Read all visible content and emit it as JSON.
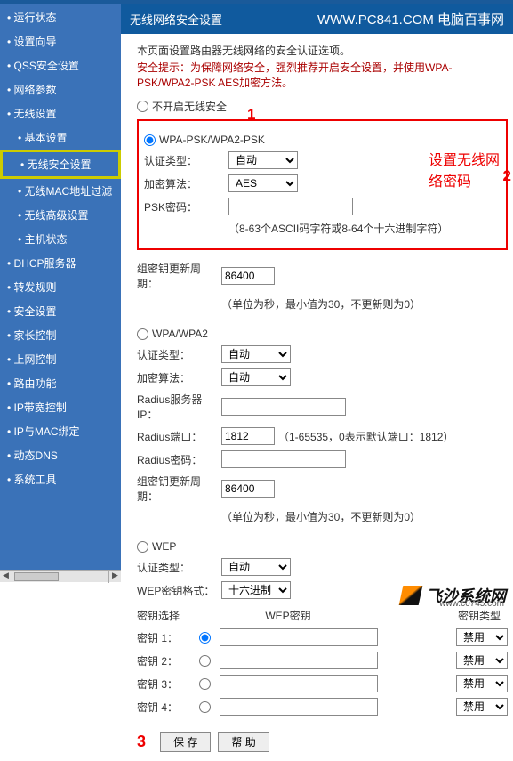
{
  "sidebar": {
    "items": [
      {
        "label": "运行状态"
      },
      {
        "label": "设置向导"
      },
      {
        "label": "QSS安全设置"
      },
      {
        "label": "网络参数"
      },
      {
        "label": "无线设置"
      },
      {
        "label": "DHCP服务器"
      },
      {
        "label": "转发规则"
      },
      {
        "label": "安全设置"
      },
      {
        "label": "家长控制"
      },
      {
        "label": "上网控制"
      },
      {
        "label": "路由功能"
      },
      {
        "label": "IP带宽控制"
      },
      {
        "label": "IP与MAC绑定"
      },
      {
        "label": "动态DNS"
      },
      {
        "label": "系统工具"
      }
    ],
    "wireless_sub": [
      {
        "label": "基本设置"
      },
      {
        "label": "无线安全设置"
      },
      {
        "label": "无线MAC地址过滤"
      },
      {
        "label": "无线高级设置"
      },
      {
        "label": "主机状态"
      }
    ]
  },
  "header": {
    "title": "无线网络安全设置",
    "brand": "WWW.PC841.COM 电脑百事网"
  },
  "intro": {
    "desc": "本页面设置路由器无线网络的安全认证选项。",
    "warn": "安全提示：为保障网络安全，强烈推荐开启安全设置，并使用WPA-PSK/WPA2-PSK AES加密方法。"
  },
  "security_modes": {
    "off": "不开启无线安全",
    "wpa_psk": "WPA-PSK/WPA2-PSK",
    "wpa": "WPA/WPA2",
    "wep": "WEP"
  },
  "wpa_psk": {
    "auth_label": "认证类型：",
    "auth_value": "自动",
    "enc_label": "加密算法：",
    "enc_value": "AES",
    "psk_label": "PSK密码：",
    "psk_hint": "（8-63个ASCII码字符或8-64个十六进制字符）"
  },
  "rekey": {
    "label": "组密钥更新周期：",
    "value": "86400",
    "hint": "（单位为秒，最小值为30，不更新则为0）"
  },
  "wpa": {
    "auth_label": "认证类型：",
    "auth_value": "自动",
    "enc_label": "加密算法：",
    "enc_value": "自动",
    "radius_ip_label": "Radius服务器IP：",
    "radius_port_label": "Radius端口：",
    "radius_port_value": "1812",
    "radius_port_hint": "（1-65535，0表示默认端口：1812）",
    "radius_pw_label": "Radius密码：",
    "rekey_label": "组密钥更新周期：",
    "rekey_value": "86400",
    "rekey_hint": "（单位为秒，最小值为30，不更新则为0）"
  },
  "wep": {
    "auth_label": "认证类型：",
    "auth_value": "自动",
    "fmt_label": "WEP密钥格式：",
    "fmt_value": "十六进制",
    "select_label": "密钥选择",
    "key_label_header": "WEP密钥",
    "type_label": "密钥类型",
    "keys": [
      {
        "label": "密钥 1：",
        "type": "禁用"
      },
      {
        "label": "密钥 2：",
        "type": "禁用"
      },
      {
        "label": "密钥 3：",
        "type": "禁用"
      },
      {
        "label": "密钥 4：",
        "type": "禁用"
      }
    ]
  },
  "buttons": {
    "save": "保 存",
    "help": "帮 助"
  },
  "annotations": {
    "one": "1",
    "two": "2",
    "three": "3",
    "pw_title": "设置无线网络密码"
  },
  "brand_footer": {
    "name": "飞沙系统网",
    "url": "www.c0745.com"
  }
}
